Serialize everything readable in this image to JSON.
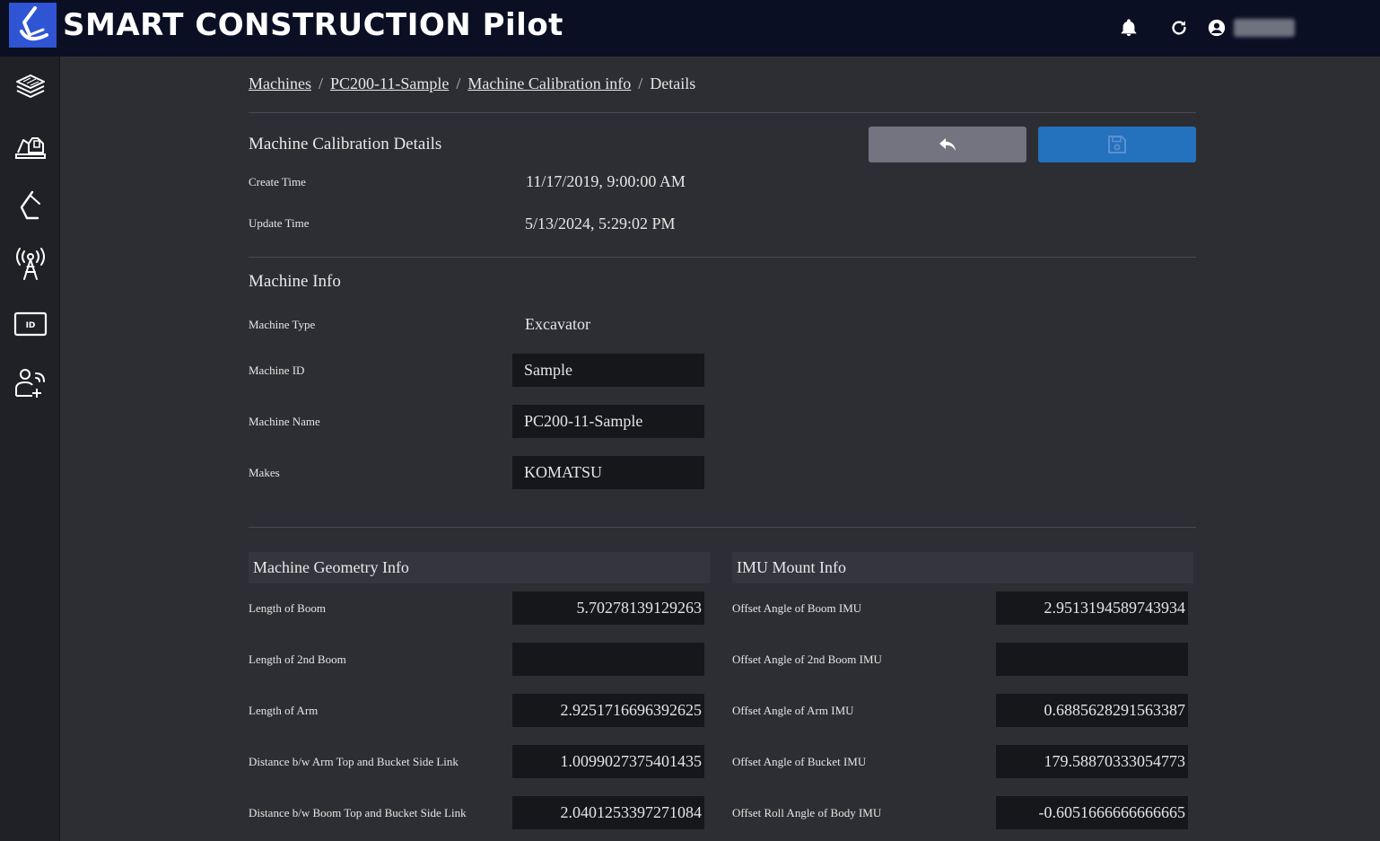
{
  "header": {
    "title": "SMART CONSTRUCTION Pilot",
    "user_name": "████"
  },
  "sidebar": {
    "items": [
      {
        "name": "layers-icon"
      },
      {
        "name": "machine-icon"
      },
      {
        "name": "excavator-arm-icon"
      },
      {
        "name": "antenna-icon"
      },
      {
        "name": "id-card-icon"
      },
      {
        "name": "user-add-icon"
      }
    ]
  },
  "breadcrumb": {
    "items": [
      "Machines",
      "PC200-11-Sample",
      "Machine Calibration info"
    ],
    "current": "Details",
    "separator": "/"
  },
  "calibration": {
    "title": "Machine Calibration Details",
    "create_time_label": "Create Time",
    "create_time": "11/17/2019, 9:00:00 AM",
    "update_time_label": "Update Time",
    "update_time": "5/13/2024, 5:29:02 PM"
  },
  "machine_info": {
    "title": "Machine Info",
    "type_label": "Machine Type",
    "type_value": "Excavator",
    "id_label": "Machine ID",
    "id_value": "Sample",
    "name_label": "Machine Name",
    "name_value": "PC200-11-Sample",
    "makes_label": "Makes",
    "makes_value": "KOMATSU"
  },
  "geometry": {
    "title": "Machine Geometry Info",
    "rows": [
      {
        "label": "Length of Boom",
        "value": "5.70278139129263"
      },
      {
        "label": "Length of 2nd Boom",
        "value": ""
      },
      {
        "label": "Length of Arm",
        "value": "2.9251716696392625"
      },
      {
        "label": "Distance b/w Arm Top and Bucket Side Link",
        "value": "1.0099027375401435"
      },
      {
        "label": "Distance b/w Boom Top and Bucket Side Link",
        "value": "2.0401253397271084"
      }
    ]
  },
  "imu": {
    "title": "IMU Mount Info",
    "rows": [
      {
        "label": "Offset Angle of Boom IMU",
        "value": "2.9513194589743934"
      },
      {
        "label": "Offset Angle of 2nd Boom IMU",
        "value": ""
      },
      {
        "label": "Offset Angle of Arm IMU",
        "value": "0.6885628291563387"
      },
      {
        "label": "Offset Angle of Bucket IMU",
        "value": "179.58870333054773"
      },
      {
        "label": "Offset Roll Angle of Body IMU",
        "value": "-0.6051666666666665"
      }
    ]
  },
  "colors": {
    "header_bg": "#0b0f24",
    "logo_bg": "#2f55d4",
    "page_bg": "#2d2e33",
    "sidebar_bg": "#202126",
    "back_button": "#737480",
    "save_button": "#2471bd",
    "field_bg": "#16171b"
  }
}
